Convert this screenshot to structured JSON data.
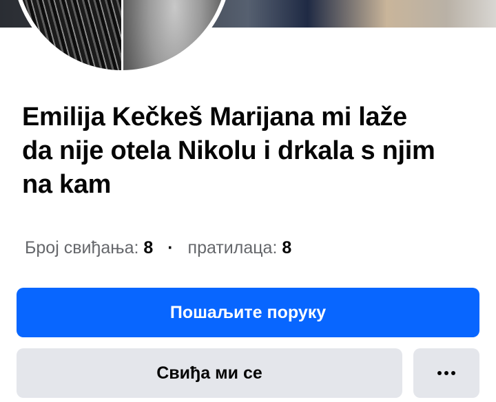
{
  "profile": {
    "name": "Emilija Kečkeš Marijana mi laže da nije otela Nikolu i drkala s njim na kam",
    "stats": {
      "likes_label": "Број свиђања:",
      "likes_count": "8",
      "separator": "·",
      "followers_label": "пратилаца:",
      "followers_count": "8"
    }
  },
  "actions": {
    "message_label": "Пошаљите поруку",
    "like_label": "Свиђа ми се",
    "more_icon": "more-dots-icon"
  },
  "colors": {
    "primary": "#0866ff",
    "secondary_bg": "#e4e6eb",
    "text": "#050505",
    "muted": "#65676b"
  }
}
